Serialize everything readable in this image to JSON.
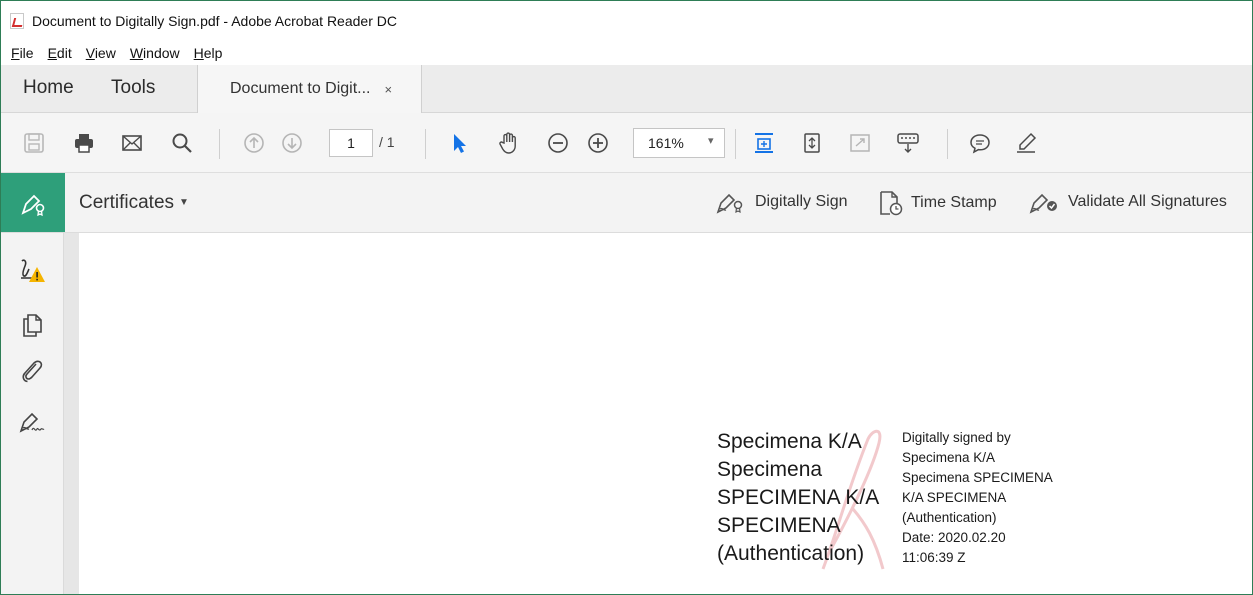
{
  "window": {
    "title": "Document to Digitally Sign.pdf - Adobe Acrobat Reader DC"
  },
  "menu": [
    "File",
    "Edit",
    "View",
    "Window",
    "Help"
  ],
  "tabs": {
    "home": "Home",
    "tools": "Tools",
    "document": "Document to Digit...",
    "close": "×"
  },
  "toolbar": {
    "icons": [
      "save-icon",
      "print-icon",
      "email-icon",
      "search-icon",
      "page-up-icon",
      "page-down-icon",
      "select-arrow-icon",
      "hand-icon",
      "zoom-out-icon",
      "zoom-in-icon",
      "fit-page-icon",
      "scroll-mode-icon",
      "full-screen-icon",
      "keyboard-icon",
      "comment-icon",
      "highlight-icon"
    ],
    "page_current": "1",
    "page_total": "/ 1",
    "zoom": "161%"
  },
  "certificates": {
    "title": "Certificates",
    "actions": {
      "digitally_sign": "Digitally Sign",
      "time_stamp": "Time Stamp",
      "validate_all": "Validate All Signatures"
    }
  },
  "left_panel": {
    "icons": [
      "signature-warning-icon",
      "pages-icon",
      "attachment-icon",
      "signature-pen-icon"
    ]
  },
  "signature": {
    "name_lines": [
      "Specimena K/A",
      "Specimena",
      "SPECIMENA K/A",
      "SPECIMENA",
      "(Authentication)"
    ],
    "detail_lines": [
      "Digitally signed by",
      "Specimena K/A",
      "Specimena SPECIMENA",
      "K/A SPECIMENA",
      "(Authentication)",
      "Date: 2020.02.20",
      "11:06:39 Z"
    ]
  },
  "colors": {
    "accent_green": "#2e9f7a",
    "select_blue": "#1473e6",
    "warning_yellow": "#f5b400"
  }
}
